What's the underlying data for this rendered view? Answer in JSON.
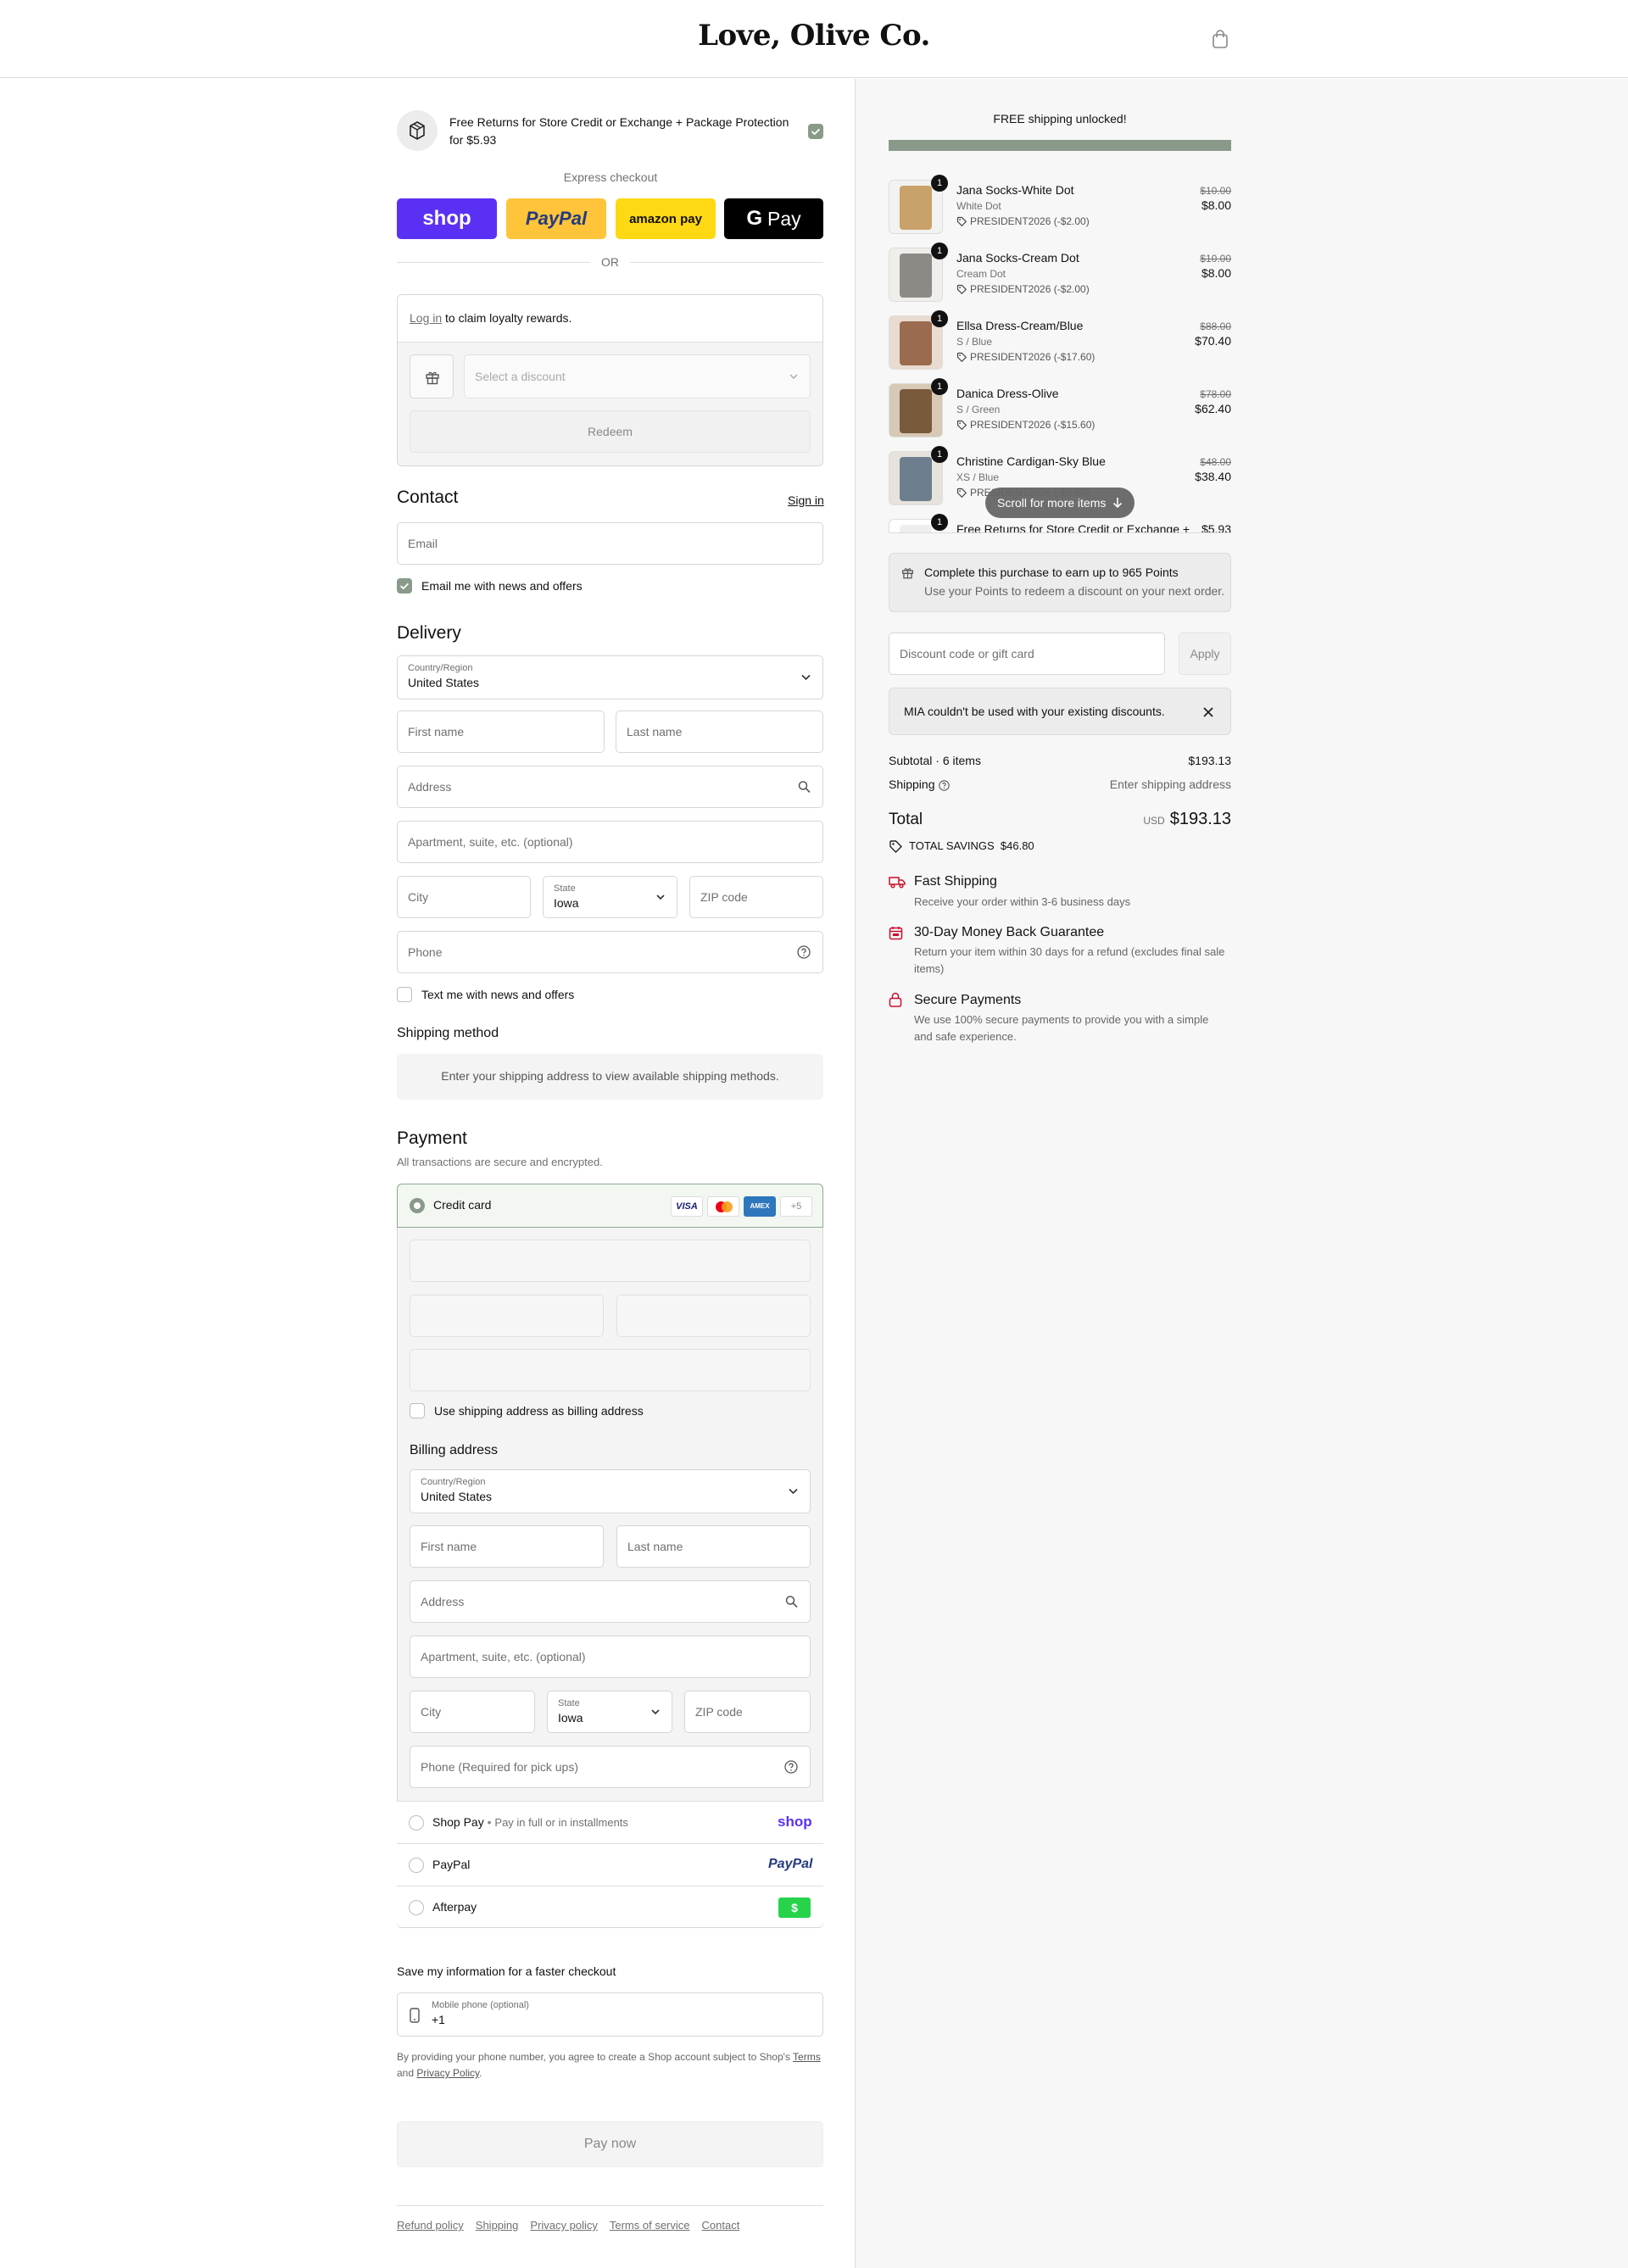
{
  "store": {
    "name": "Love, Olive Co."
  },
  "upsell": {
    "text": "Free Returns for Store Credit or Exchange + Package Protection for $5.93"
  },
  "express": {
    "label": "Express checkout",
    "shop": "shop",
    "paypal": "PayPal",
    "amazon": "amazon pay",
    "gpay": "Pay",
    "or": "OR"
  },
  "loyalty": {
    "login": "Log in",
    "text": " to claim loyalty rewards.",
    "select_placeholder": "Select a discount",
    "redeem": "Redeem"
  },
  "contact": {
    "title": "Contact",
    "sign_in": "Sign in",
    "email_placeholder": "Email",
    "news_label": "Email me with news and offers"
  },
  "delivery": {
    "title": "Delivery",
    "country_label": "Country/Region",
    "country_value": "United States",
    "first_name": "First name",
    "last_name": "Last name",
    "address": "Address",
    "apartment": "Apartment, suite, etc. (optional)",
    "city": "City",
    "state_label": "State",
    "state_value": "Iowa",
    "zip": "ZIP code",
    "phone": "Phone",
    "text_label": "Text me with news and offers"
  },
  "shipping_method": {
    "title": "Shipping method",
    "message": "Enter your shipping address to view available shipping methods."
  },
  "payment": {
    "title": "Payment",
    "subtitle": "All transactions are secure and encrypted.",
    "credit_card": "Credit card",
    "more_cards": "+5",
    "same_billing": "Use shipping address as billing address",
    "billing_title": "Billing address",
    "billing_phone": "Phone (Required for pick ups)",
    "shop_pay": "Shop Pay",
    "shop_pay_sub": "Pay in full or in installments",
    "paypal": "PayPal",
    "afterpay": "Afterpay",
    "afterpay_badge": "$"
  },
  "save": {
    "title": "Save my information for a faster checkout",
    "mobile_label": "Mobile phone (optional)",
    "mobile_value": "+1",
    "legal_1": "By providing your phone number, you agree to create a Shop account subject to Shop's ",
    "terms": "Terms",
    "legal_2": "and ",
    "privacy": "Privacy Policy",
    "legal_3": "."
  },
  "pay_now": "Pay now",
  "footer_links": [
    "Refund policy",
    "Shipping",
    "Privacy policy",
    "Terms of service",
    "Contact"
  ],
  "summary": {
    "shipping_banner": "FREE shipping unlocked!",
    "progress": 1.0,
    "items": [
      {
        "name": "Jana Socks-White Dot",
        "variant": "White Dot",
        "code": "PRESIDENT2026 (-$2.00)",
        "old": "$10.00",
        "price": "$8.00",
        "qty": "1"
      },
      {
        "name": "Jana Socks-Cream Dot",
        "variant": "Cream Dot",
        "code": "PRESIDENT2026 (-$2.00)",
        "old": "$10.00",
        "price": "$8.00",
        "qty": "1"
      },
      {
        "name": "Ellsa Dress-Cream/Blue",
        "variant": "S / Blue",
        "code": "PRESIDENT2026 (-$17.60)",
        "old": "$88.00",
        "price": "$70.40",
        "qty": "1"
      },
      {
        "name": "Danica Dress-Olive",
        "variant": "S / Green",
        "code": "PRESIDENT2026 (-$15.60)",
        "old": "$78.00",
        "price": "$62.40",
        "qty": "1"
      },
      {
        "name": "Christine Cardigan-Sky Blue",
        "variant": "XS / Blue",
        "code": "PRESIDENT2026 (-$9.60)",
        "old": "$48.00",
        "price": "$38.40",
        "qty": "1"
      },
      {
        "name": "Free Returns for Store Credit or Exchange +",
        "variant": "",
        "code": "",
        "old": "",
        "price": "$5.93",
        "qty": "1"
      }
    ],
    "scroll_hint": "Scroll for more items",
    "points_title": "Complete this purchase to earn up to 965 Points",
    "points_sub": "Use your Points to redeem a discount on your next order.",
    "discount_placeholder": "Discount code or gift card",
    "apply": "Apply",
    "error": "MIA couldn't be used with your existing discounts.",
    "subtotal_label": "Subtotal · 6 items",
    "subtotal": "$193.13",
    "shipping_label": "Shipping",
    "shipping_value": "Enter shipping address",
    "total_label": "Total",
    "currency": "USD",
    "total": "$193.13",
    "savings_label": "TOTAL SAVINGS",
    "savings": "$46.80",
    "features": [
      {
        "title": "Fast Shipping",
        "desc": "Receive your order within 3-6 business days"
      },
      {
        "title": "30-Day Money Back Guarantee",
        "desc": "Return your item within 30 days for a refund (excludes final sale items)"
      },
      {
        "title": "Secure Payments",
        "desc": "We use 100% secure payments to provide you with a simple and safe experience."
      }
    ]
  },
  "colors": {
    "accent": "#8a9a8a",
    "shop_purple": "#5a31f4",
    "paypal_yellow": "#ffc439",
    "amazon_yellow": "#ffd814",
    "error_red": "#c8102e",
    "afterpay_green": "#27d34b"
  }
}
